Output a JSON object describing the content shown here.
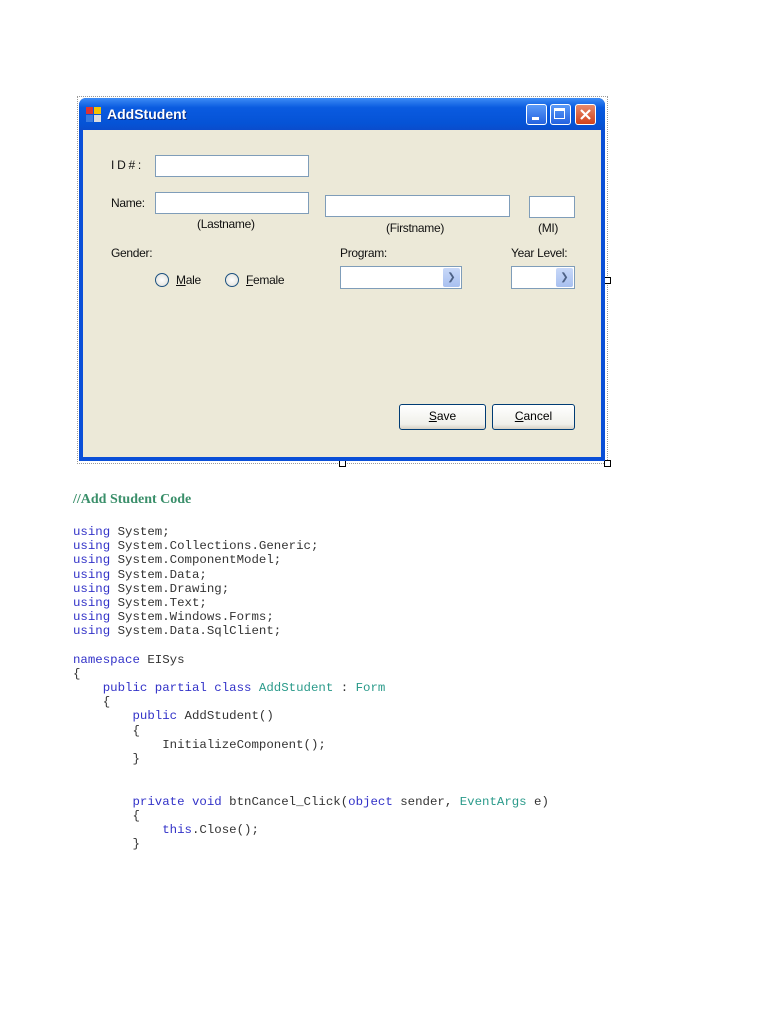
{
  "window": {
    "title": "AddStudent",
    "labels": {
      "id": "I D # :",
      "name": "Name:",
      "lastname_caption": "(Lastname)",
      "firstname_caption": "(Firstname)",
      "mi_caption": "(MI)",
      "gender": "Gender:",
      "program": "Program:",
      "year_level": "Year Level:"
    },
    "fields": {
      "id": "",
      "lastname": "",
      "firstname": "",
      "mi": "",
      "program": "",
      "year_level": ""
    },
    "radios": {
      "male_key": "M",
      "male_rest": "ale",
      "female_key": "F",
      "female_rest": "emale"
    },
    "buttons": {
      "save_key": "S",
      "save_rest": "ave",
      "cancel_key": "C",
      "cancel_rest": "ancel"
    }
  },
  "heading": "//Add Student Code",
  "code_lines": [
    [
      [
        "kw",
        "using"
      ],
      [
        "",
        "System;"
      ]
    ],
    [
      [
        "kw",
        "using"
      ],
      [
        "",
        "System.Collections.Generic;"
      ]
    ],
    [
      [
        "kw",
        "using"
      ],
      [
        "",
        "System.ComponentModel;"
      ]
    ],
    [
      [
        "kw",
        "using"
      ],
      [
        "",
        "System.Data;"
      ]
    ],
    [
      [
        "kw",
        "using"
      ],
      [
        "",
        "System.Drawing;"
      ]
    ],
    [
      [
        "kw",
        "using"
      ],
      [
        "",
        "System.Text;"
      ]
    ],
    [
      [
        "kw",
        "using"
      ],
      [
        "",
        "System.Windows.Forms;"
      ]
    ],
    [
      [
        "kw",
        "using"
      ],
      [
        "",
        "System.Data.SqlClient;"
      ]
    ],
    [],
    [
      [
        "kw",
        "namespace"
      ],
      [
        "",
        "EISys"
      ]
    ],
    [
      [
        "",
        "{"
      ]
    ],
    [
      [
        "",
        "    "
      ],
      [
        "kw",
        "public partial class"
      ],
      [
        "ty",
        "AddStudent"
      ],
      [
        "",
        ":"
      ],
      [
        "ty",
        "Form"
      ]
    ],
    [
      [
        "",
        "    {"
      ]
    ],
    [
      [
        "",
        "        "
      ],
      [
        "kw",
        "public"
      ],
      [
        "",
        "AddStudent()"
      ]
    ],
    [
      [
        "",
        "        {"
      ]
    ],
    [
      [
        "",
        "            InitializeComponent();"
      ]
    ],
    [
      [
        "",
        "        }"
      ]
    ],
    [],
    [],
    [
      [
        "",
        "        "
      ],
      [
        "kw",
        "private void"
      ],
      [
        "",
        "btnCancel_Click("
      ],
      [
        "kw",
        "object"
      ],
      [
        "",
        "sender,"
      ],
      [
        "ty",
        "EventArgs"
      ],
      [
        "",
        "e)"
      ]
    ],
    [
      [
        "",
        "        {"
      ]
    ],
    [
      [
        "",
        "            "
      ],
      [
        "kw",
        "this"
      ],
      [
        "",
        ".Close();"
      ]
    ],
    [
      [
        "",
        "        }"
      ]
    ]
  ]
}
